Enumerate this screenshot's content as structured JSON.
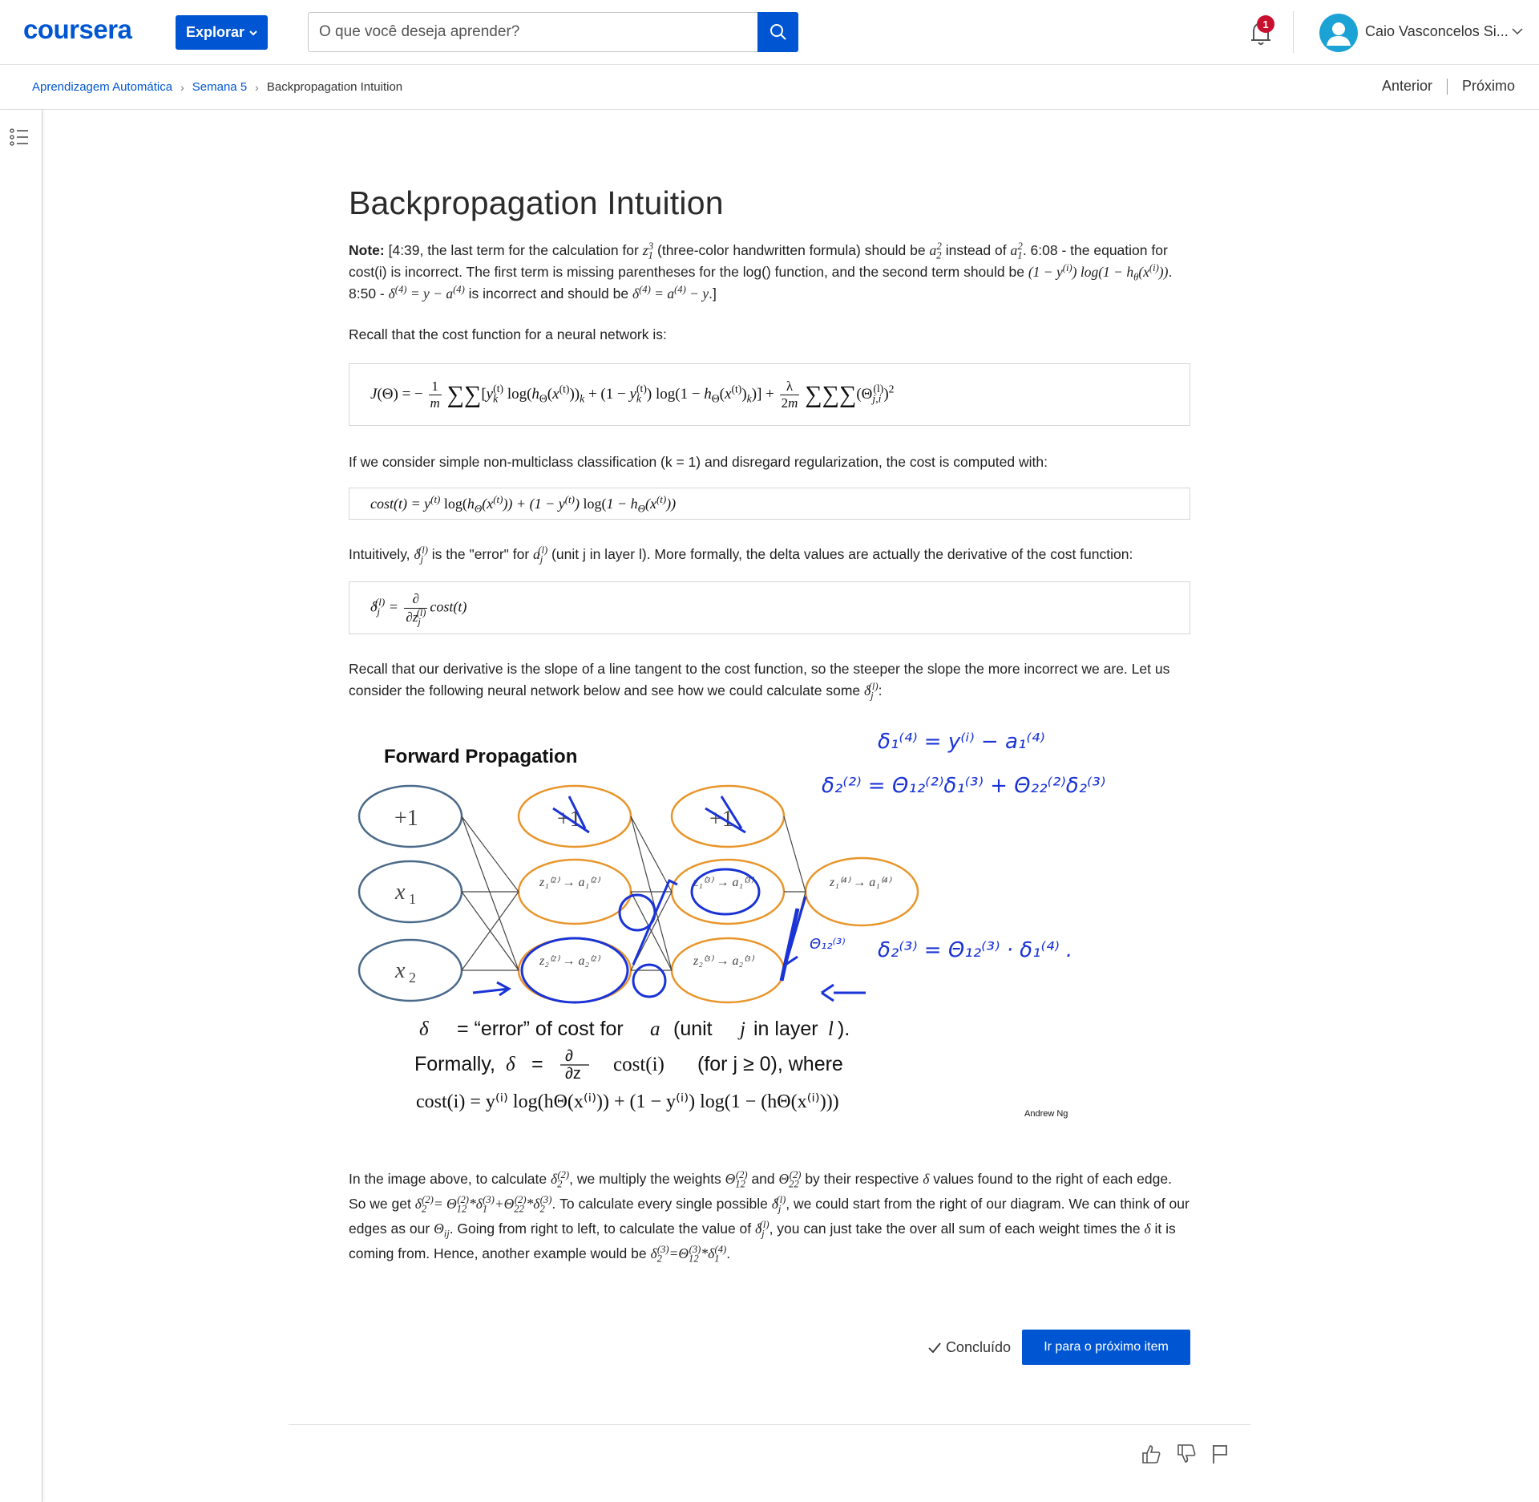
{
  "header": {
    "logo": "coursera",
    "explore_label": "Explorar",
    "search_placeholder": "O que você deseja aprender?",
    "notification_count": "1",
    "user_name": "Caio Vasconcelos Si..."
  },
  "breadcrumb": {
    "items": [
      "Aprendizagem Automática",
      "Semana 5",
      "Backpropagation Intuition"
    ]
  },
  "nav": {
    "previous": "Anterior",
    "next": "Próximo"
  },
  "article": {
    "title": "Backpropagation Intuition",
    "note_label": "Note:",
    "note_part1": "[4:39, the last term for the calculation for",
    "note_part2": "(three-color handwritten formula) should be",
    "note_part3": "instead of",
    "note_part4": ". 6:08 - the equation for cost(i) is incorrect. The first term is missing parentheses for the log() function, and the second term should be",
    "note_part5": ". 8:50 -",
    "note_part6": "is incorrect and should be",
    "note_part7": ".]",
    "p_recall": "Recall that the cost function for a neural network is:",
    "p_simple": "If we consider simple non-multiclass classification (k = 1) and disregard regularization, the cost is computed with:",
    "p_intuit_1": "Intuitively,",
    "p_intuit_2": "is the \"error\" for",
    "p_intuit_3": "(unit j in layer l). More formally, the delta values are actually the derivative of the cost function:",
    "p_slope": "Recall that our derivative is the slope of a line tangent to the cost function, so the steeper the slope the more incorrect we are. Let us consider the following neural network below and see how we could calculate some",
    "p_image_1": "In the image above, to calculate",
    "p_image_2": ", we multiply the weights",
    "p_image_3": "and",
    "p_image_4": "by their respective",
    "p_image_5": "values found to the right of each edge. So we get",
    "p_image_6": ". To calculate every single possible",
    "p_image_7": ", we could start from the right of our diagram. We can think of our edges as our",
    "p_image_8": ". Going from right to left, to calculate the value of",
    "p_image_9": ", you can just take the over all sum of each weight times the",
    "p_image_10": "it is coming from. Hence, another example would be"
  },
  "figure": {
    "title": "Forward Propagation",
    "bias": "+1",
    "x1": "x",
    "x2": "x",
    "error_line_1": "= “error” of cost for",
    "error_line_1b": "(unit",
    "error_line_1c": "in layer",
    "formally_label": "Formally,",
    "for_where": "(for j ≥ 0), where",
    "credit": "Andrew Ng"
  },
  "actions": {
    "done_label": "Concluído",
    "next_item_label": "Ir para o próximo item"
  },
  "colors": {
    "brand": "#0056d2",
    "badge": "#c8102e",
    "node_orange": "#e8952a",
    "node_blue": "#4a6a8a",
    "ink": "#1a33d6"
  },
  "icons": [
    "search-icon",
    "bell-icon",
    "user-icon",
    "chevron-down-icon",
    "list-icon",
    "check-icon",
    "thumbs-up-icon",
    "thumbs-down-icon",
    "flag-icon"
  ]
}
